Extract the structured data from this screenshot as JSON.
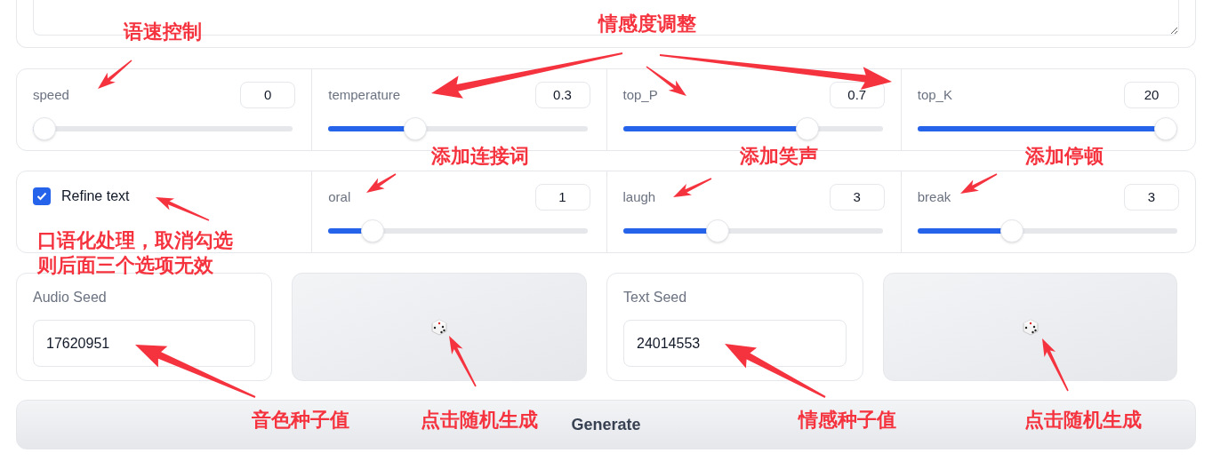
{
  "sliders_row_1": [
    {
      "label": "speed",
      "value": "0",
      "level": 0
    },
    {
      "label": "temperature",
      "value": "0.3",
      "level": 0.32
    },
    {
      "label": "top_P",
      "value": "0.7",
      "level": 0.73
    },
    {
      "label": "top_K",
      "value": "20",
      "level": 1
    }
  ],
  "options_row": {
    "refine_text": {
      "label": "Refine text",
      "checked": true
    },
    "sliders": [
      {
        "label": "oral",
        "value": "1",
        "level": 0.14
      },
      {
        "label": "laugh",
        "value": "3",
        "level": 0.35
      },
      {
        "label": "break",
        "value": "3",
        "level": 0.35
      }
    ]
  },
  "seeds": [
    {
      "label": "Audio Seed",
      "value": "17620951"
    },
    {
      "label": "Text Seed",
      "value": "24014553"
    }
  ],
  "generate_button": {
    "label": "Generate"
  },
  "annotations": [
    {
      "text": "语速控制"
    },
    {
      "text": "情感度调整"
    },
    {
      "text": "添加连接词"
    },
    {
      "text": "添加笑声"
    },
    {
      "text": "添加停顿"
    },
    {
      "lines": [
        "口语化处理，取消勾选",
        "则后面三个选项无效"
      ]
    },
    {
      "text": "音色种子值"
    },
    {
      "text": "点击随机生成"
    },
    {
      "text": "情感种子值"
    },
    {
      "text": "点击随机生成"
    }
  ]
}
